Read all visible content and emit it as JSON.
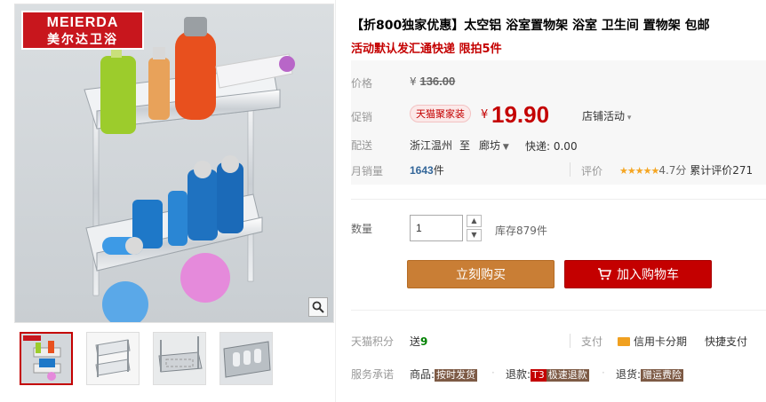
{
  "brand": {
    "en": "MEIERDA",
    "cn": "美尔达卫浴"
  },
  "product": {
    "title": "【折800独家优惠】太空铝 浴室置物架 浴室 卫生间 置物架 包邮",
    "subtitle": "活动默认发汇通快递 限拍5件"
  },
  "price": {
    "label": "价格",
    "currency": "¥",
    "original": "136.00"
  },
  "promo": {
    "label": "促销",
    "badge": "天猫聚家装",
    "currency": "¥",
    "current": "19.90",
    "shop_promo": "店铺活动"
  },
  "shipping": {
    "label": "配送",
    "from": "浙江温州",
    "to_word": "至",
    "dest": "廊坊",
    "express": "快递: 0.00"
  },
  "sales": {
    "label": "月销量",
    "count": "1643",
    "unit": "件",
    "rating_label": "评价",
    "stars": "★★★★★",
    "score": "4.7分",
    "review_count": "累计评价271"
  },
  "quantity": {
    "label": "数量",
    "value": "1",
    "stock": "库存879件"
  },
  "actions": {
    "buy": "立刻购买",
    "cart": "加入购物车"
  },
  "points": {
    "label": "天猫积分",
    "give_word": "送",
    "value": "9",
    "pay_label": "支付",
    "credit": "信用卡分期",
    "fast_pay": "快捷支付"
  },
  "promise": {
    "label": "服务承诺",
    "items": [
      {
        "prefix": "商品:",
        "tag": "按时发货"
      },
      {
        "prefix": "退款:",
        "tag_code": "T3",
        "tag": "极速退款"
      },
      {
        "prefix": "退货:",
        "tag": "赠运费险"
      }
    ]
  },
  "colors": {
    "accent": "#c40000",
    "buy": "#c97e35",
    "star": "#f5a623",
    "points": "#008000"
  }
}
